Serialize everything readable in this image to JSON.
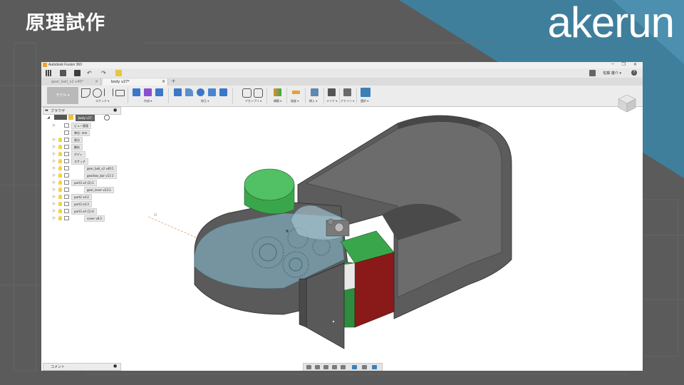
{
  "slide": {
    "title": "原理試作",
    "logo": "akerun"
  },
  "window": {
    "app_title": "Autodesk Fusion 360",
    "user_name": "佐藤 雄介 ▾",
    "help_label": "?"
  },
  "tabs": [
    {
      "label": "gear_ball_v2 v40*",
      "active": false
    },
    {
      "label": "body v27*",
      "active": true
    }
  ],
  "ribbon": {
    "mode_label": "モデル ▾",
    "groups": [
      {
        "label": "スケッチ ▾"
      },
      {
        "label": "作成 ▾"
      },
      {
        "label": "修正 ▾"
      },
      {
        "label": "アセンブリ ▾"
      },
      {
        "label": "構築 ▾"
      },
      {
        "label": "検査 ▾"
      },
      {
        "label": "挿入 ▾"
      },
      {
        "label": "メイク ▾"
      },
      {
        "label": "アドイン ▾"
      },
      {
        "label": "選択 ▾"
      }
    ]
  },
  "browser": {
    "header": "ブラウザ",
    "root": "body v27",
    "items": [
      {
        "label": "ビュー管理",
        "arrow": "▷"
      },
      {
        "label": "単位: mm",
        "arrow": ""
      },
      {
        "label": "原点",
        "arrow": "▷"
      },
      {
        "label": "解析",
        "arrow": "▷"
      },
      {
        "label": "ボディ",
        "arrow": "▷"
      },
      {
        "label": "スケッチ",
        "arrow": "▷"
      },
      {
        "label": "gear_ball_v2 v40:1",
        "arrow": "▷"
      },
      {
        "label": "gearbox_bar v11:1",
        "arrow": "▷"
      },
      {
        "label": "part3 v4 (2):1",
        "arrow": "▷"
      },
      {
        "label": "gear_lever v23:1",
        "arrow": "▷"
      },
      {
        "label": "part2 v4:2",
        "arrow": "▷"
      },
      {
        "label": "part3 v4:3",
        "arrow": "▷"
      },
      {
        "label": "part3 v4 (1):4",
        "arrow": "▷"
      },
      {
        "label": "cover v6:1",
        "arrow": "▷"
      }
    ]
  },
  "comments": {
    "label": "コメント"
  },
  "colors": {
    "slide_bg": "#5a5a5a",
    "accent_blue": "#3e7d9a",
    "model_gray": "#5b5b5b",
    "model_green": "#3aa64c",
    "model_red": "#8a1a1a",
    "model_glass": "#7fa8b8",
    "selection_blue": "#3d7fb7"
  }
}
